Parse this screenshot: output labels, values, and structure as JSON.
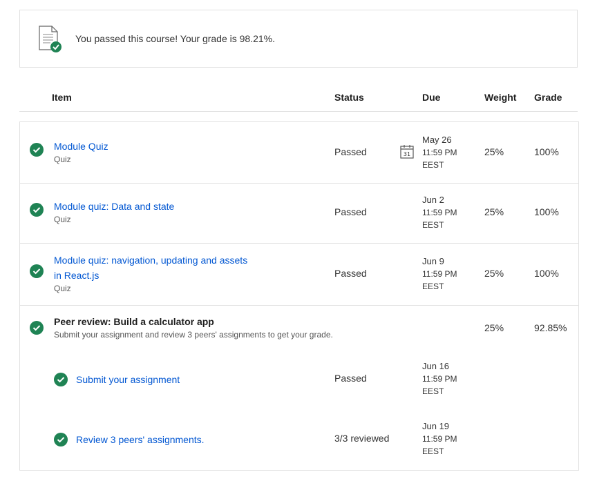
{
  "banner": {
    "message": "You passed this course! Your grade is 98.21%.",
    "icon": "document-check-icon"
  },
  "table": {
    "headers": {
      "item": "Item",
      "status": "Status",
      "due": "Due",
      "weight": "Weight",
      "grade": "Grade"
    }
  },
  "rows": [
    {
      "title": "Module Quiz",
      "type": "Quiz",
      "status": "Passed",
      "due_date": "May 26",
      "due_time": "11:59 PM",
      "due_tz": "EEST",
      "weight": "25%",
      "grade": "100%",
      "calendar_icon_label": "31"
    },
    {
      "title": "Module quiz: Data and state",
      "type": "Quiz",
      "status": "Passed",
      "due_date": "Jun 2",
      "due_time": "11:59 PM",
      "due_tz": "EEST",
      "weight": "25%",
      "grade": "100%"
    },
    {
      "title_line1": "Module quiz: navigation, updating and assets",
      "title_line2": "in React.js",
      "type": "Quiz",
      "status": "Passed",
      "due_date": "Jun 9",
      "due_time": "11:59 PM",
      "due_tz": "EEST",
      "weight": "25%",
      "grade": "100%"
    },
    {
      "title": "Peer review: Build a calculator app",
      "description": "Submit your assignment and review 3 peers' assignments to get your grade.",
      "weight": "25%",
      "grade": "92.85%",
      "subitems": [
        {
          "title": "Submit your assignment",
          "status": "Passed",
          "due_date": "Jun 16",
          "due_time": "11:59 PM",
          "due_tz": "EEST"
        },
        {
          "title": "Review 3 peers' assignments.",
          "status": "3/3 reviewed",
          "due_date": "Jun 19",
          "due_time": "11:59 PM",
          "due_tz": "EEST"
        }
      ]
    }
  ],
  "colors": {
    "link": "#0056d2",
    "success": "#1f8354",
    "border": "#e1e1e1"
  }
}
